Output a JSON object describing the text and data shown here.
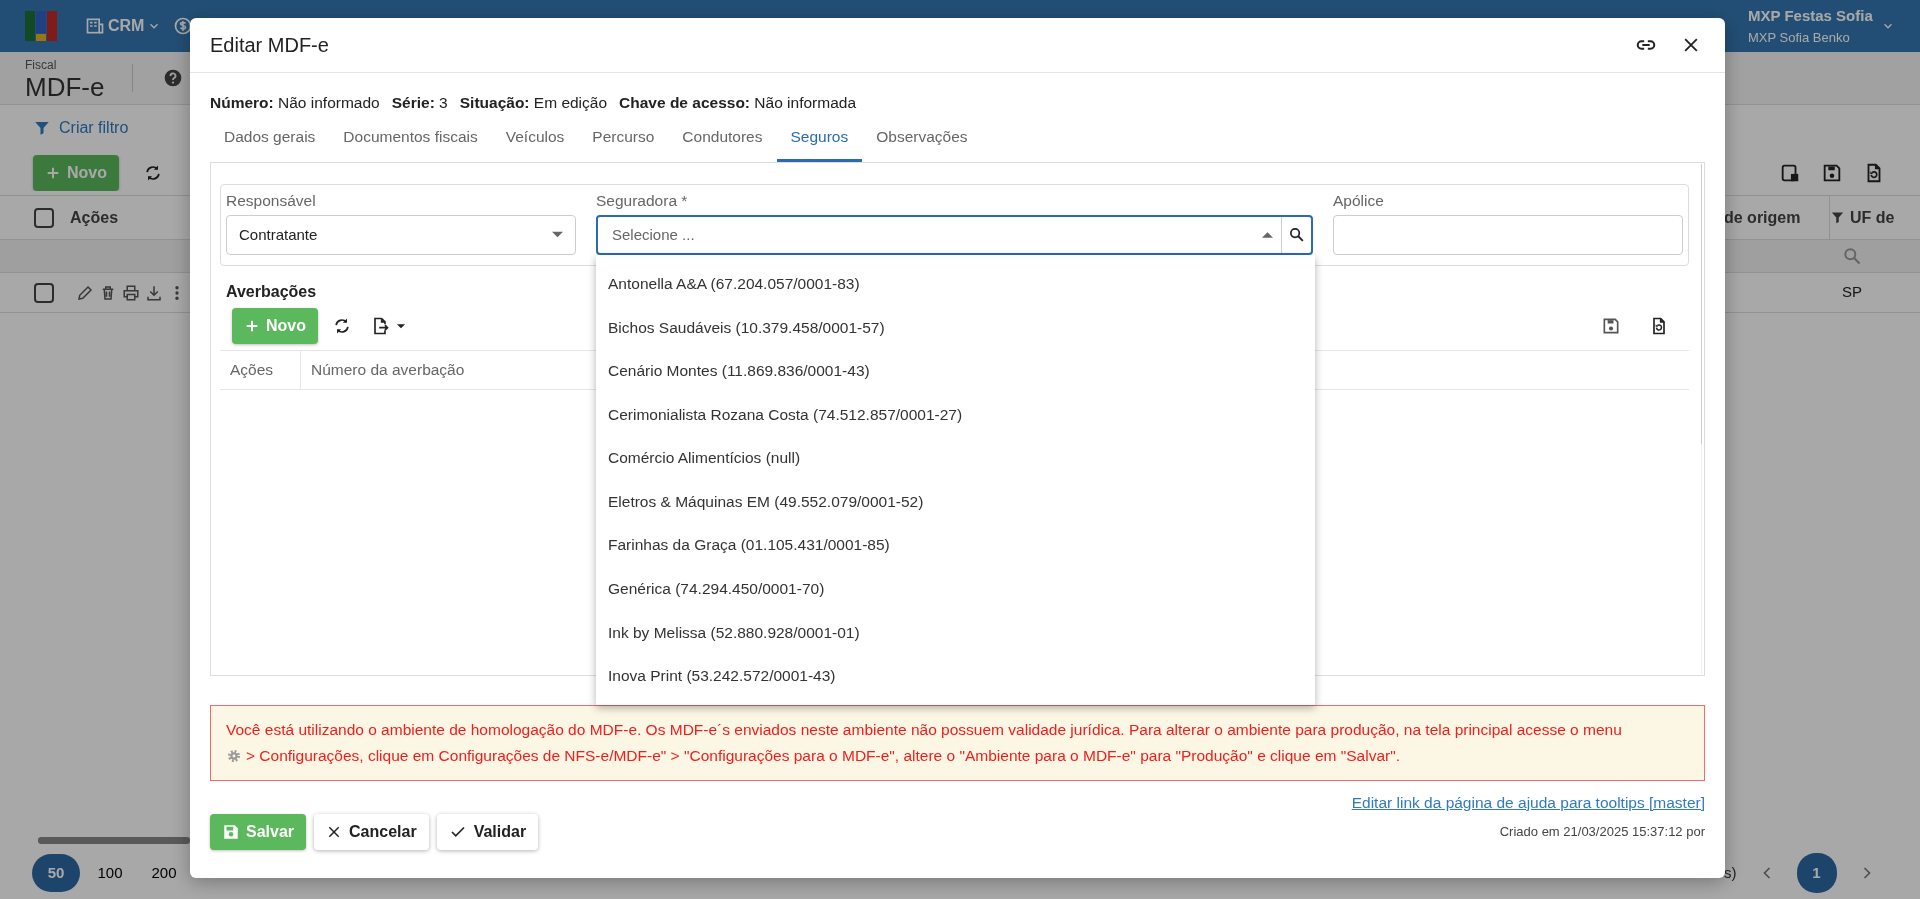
{
  "top_bar": {
    "menu": "CRM",
    "user_company": "MXP Festas Sofia",
    "user_name": "MXP Sofia Benko"
  },
  "page_header": {
    "section": "Fiscal",
    "title": "MDF-e"
  },
  "filter_link": "Criar filtro",
  "toolbar": {
    "new_button": "Novo"
  },
  "grid": {
    "select_all_checked": false,
    "left_column": "Ações",
    "right_columns": [
      "de origem",
      "UF de"
    ],
    "rows": [
      {
        "checked": false,
        "uf": "SP"
      }
    ]
  },
  "pagination": {
    "page_sizes": [
      {
        "label": "50",
        "selected": true
      },
      {
        "label": "100",
        "selected": false
      },
      {
        "label": "200",
        "selected": false
      }
    ],
    "tail_text": "s)",
    "pages": [
      {
        "label": "1",
        "selected": true
      }
    ]
  },
  "modal": {
    "title": "Editar MDF-e",
    "info": [
      {
        "label": "Número:",
        "value": "Não informado"
      },
      {
        "label": "Série:",
        "value": "3"
      },
      {
        "label": "Situação:",
        "value": "Em edição"
      },
      {
        "label": "Chave de acesso:",
        "value": "Não informada"
      }
    ],
    "tabs": [
      {
        "label": "Dados gerais",
        "selected": false
      },
      {
        "label": "Documentos fiscais",
        "selected": false
      },
      {
        "label": "Veículos",
        "selected": false
      },
      {
        "label": "Percurso",
        "selected": false
      },
      {
        "label": "Condutores",
        "selected": false
      },
      {
        "label": "Seguros",
        "selected": true
      },
      {
        "label": "Observações",
        "selected": false
      }
    ],
    "fields": [
      {
        "kind": "select",
        "label": "Responsável",
        "value": "Contratante"
      },
      {
        "kind": "search-select",
        "label": "Seguradora *",
        "placeholder": "Selecione ...",
        "expanded": true,
        "options": [
          "Antonella A&A (67.204.057/0001-83)",
          "Bichos Saudáveis (10.379.458/0001-57)",
          "Cenário Montes (11.869.836/0001-43)",
          "Cerimonialista Rozana Costa (74.512.857/0001-27)",
          "Comércio Alimentícios (null)",
          "Eletros & Máquinas EM (49.552.079/0001-52)",
          "Farinhas da Graça (01.105.431/0001-85)",
          "Genérica (74.294.450/0001-70)",
          "Ink by Melissa (52.880.928/0001-01)",
          "Inova Print (53.242.572/0001-43)"
        ]
      },
      {
        "kind": "text",
        "label": "Apólice"
      }
    ],
    "averbacoes": {
      "title": "Averbações",
      "new_button": "Novo",
      "columns": [
        "Ações",
        "Número da averbação"
      ]
    },
    "alert": {
      "line_1": "Você está utilizando o ambiente de homologação do MDF-e. Os MDF-e´s enviados neste ambiente não possuem validade jurídica. Para alterar o ambiente para produção, na tela principal acesse o menu",
      "line_2": "> Configurações, clique em Configurações de NFS-e/MDF-e\" > \"Configurações para o MDF-e\", altere o \"Ambiente para o MDF-e\" para \"Produção\" e clique em \"Salvar\"."
    },
    "help_link": "Editar link da página de ajuda para tooltips [master]",
    "buttons": [
      {
        "kind": "save",
        "label": "Salvar"
      },
      {
        "kind": "cancel",
        "label": "Cancelar"
      },
      {
        "kind": "validate",
        "label": "Validar"
      }
    ],
    "created": "Criado em 21/03/2025 15:37:12 por"
  }
}
